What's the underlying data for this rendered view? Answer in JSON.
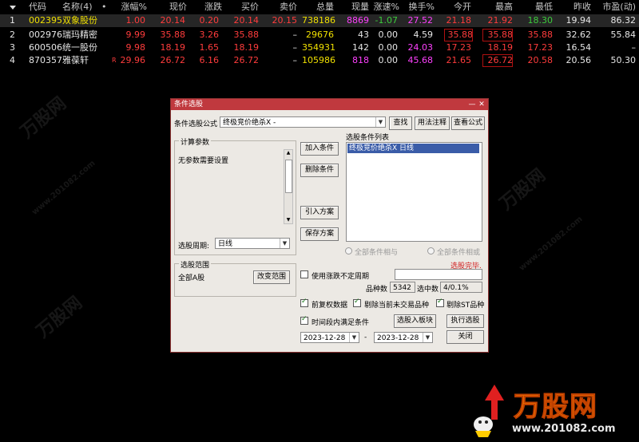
{
  "table": {
    "headers": [
      "代码",
      "名称(4)",
      "•",
      "涨幅%",
      "现价",
      "涨跌",
      "买价",
      "卖价",
      "总量",
      "现量",
      "涨速%",
      "换手%",
      "今开",
      "最高",
      "最低",
      "昨收",
      "市盈(动)"
    ],
    "rows": [
      {
        "idx": "1",
        "code": "002395",
        "name": "双象股份",
        "flag": "",
        "chg_pct": "1.00",
        "price": "20.14",
        "chg": "0.20",
        "bid": "20.14",
        "ask": "20.15",
        "vol": "738186",
        "cur_vol": "8869",
        "speed": "-1.07",
        "turnover": "27.52",
        "open": "21.18",
        "high": "21.92",
        "low": "18.30",
        "prev": "19.94",
        "pe": "86.32"
      },
      {
        "idx": "2",
        "code": "002976",
        "name": "瑞玛精密",
        "flag": "",
        "chg_pct": "9.99",
        "price": "35.88",
        "chg": "3.26",
        "bid": "35.88",
        "ask": "–",
        "vol": "29676",
        "cur_vol": "43",
        "speed": "0.00",
        "turnover": "4.59",
        "open": "35.88",
        "high": "35.88",
        "low": "35.88",
        "prev": "32.62",
        "pe": "55.84"
      },
      {
        "idx": "3",
        "code": "600506",
        "name": "统一股份",
        "flag": "",
        "chg_pct": "9.98",
        "price": "18.19",
        "chg": "1.65",
        "bid": "18.19",
        "ask": "–",
        "vol": "354931",
        "cur_vol": "142",
        "speed": "0.00",
        "turnover": "24.03",
        "open": "17.23",
        "high": "18.19",
        "low": "17.23",
        "prev": "16.54",
        "pe": "–"
      },
      {
        "idx": "4",
        "code": "870357",
        "name": "雅葆轩",
        "flag": "R",
        "chg_pct": "29.96",
        "price": "26.72",
        "chg": "6.16",
        "bid": "26.72",
        "ask": "–",
        "vol": "105986",
        "cur_vol": "818",
        "speed": "0.00",
        "turnover": "45.68",
        "open": "21.65",
        "high": "26.72",
        "low": "20.58",
        "prev": "20.56",
        "pe": "50.30"
      }
    ]
  },
  "dialog": {
    "title": "条件选股",
    "formula_label": "条件选股公式",
    "formula_value": "终极竞价绝杀X  -",
    "find_btn": "查找",
    "usage_btn": "用法注释",
    "view_formula_btn": "查看公式",
    "params_group": "计算参数",
    "no_params_text": "无参数需要设置",
    "period_label": "选股周期:",
    "period_value": "日线",
    "add_cond_btn": "加入条件",
    "del_cond_btn": "删除条件",
    "import_plan_btn": "引入方案",
    "save_plan_btn": "保存方案",
    "cond_list_label": "选股条件列表",
    "cond_items": [
      "终极竞价绝杀X  日线"
    ],
    "radio_and": "全部条件相与",
    "radio_or": "全部条件相或",
    "done_text": "选股完毕.",
    "range_group": "选股范围",
    "range_value": "全部A股",
    "change_range_btn": "改变范围",
    "use_indef_period": "使用涨跌不定周期",
    "count_label": "品种数",
    "count_value": "5342",
    "selected_label": "选中数",
    "selected_value": "4/0.1%",
    "pre_adjust": "前复权数据",
    "exclude_untraded": "剔除当前未交易品种",
    "exclude_st": "剔除ST品种",
    "time_range": "时间段内满足条件",
    "to_block_btn": "选股入板块",
    "run_btn": "执行选股",
    "date_from": "2023-12-28",
    "date_sep": "-",
    "date_to": "2023-12-28",
    "close_btn": "关闭"
  },
  "watermark": {
    "brand": "万股网",
    "url": "www.201082.com"
  }
}
